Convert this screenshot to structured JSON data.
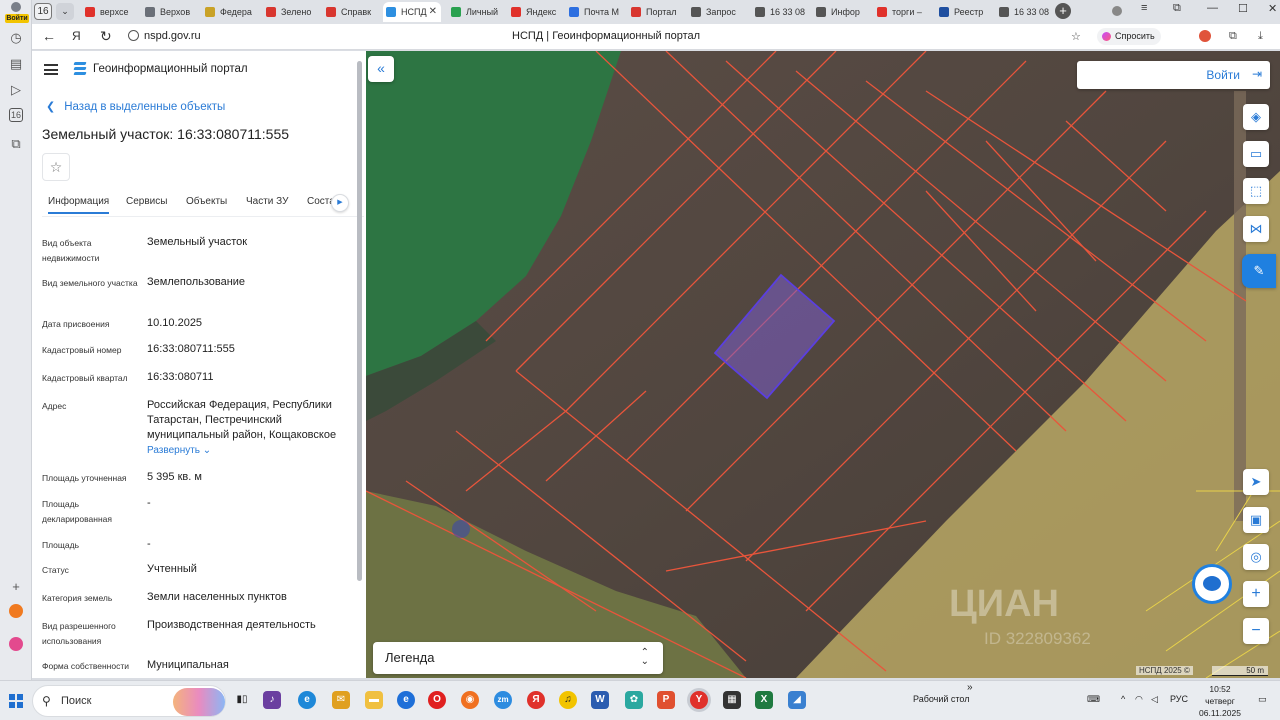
{
  "browser": {
    "tab_count": "16",
    "tabs": [
      {
        "label": "верхсе",
        "color": "#e0312b"
      },
      {
        "label": "Верхов",
        "color": "#6a6f78"
      },
      {
        "label": "Федера",
        "color": "#c9a227"
      },
      {
        "label": "Зелено",
        "color": "#d8362f"
      },
      {
        "label": "Справк",
        "color": "#d8362f"
      },
      {
        "label": "НСПД",
        "color": "#2d8fe0"
      },
      {
        "label": "Личный",
        "color": "#2aa150"
      },
      {
        "label": "Яндекс",
        "color": "#e0312b"
      },
      {
        "label": "Почта М",
        "color": "#2d6fe0"
      },
      {
        "label": "Портал",
        "color": "#d8362f"
      },
      {
        "label": "Запрос",
        "color": "#555"
      },
      {
        "label": "16 33 08",
        "color": "#555"
      },
      {
        "label": "Инфор",
        "color": "#555"
      },
      {
        "label": "торги –",
        "color": "#e0312b"
      },
      {
        "label": "Реестр",
        "color": "#1f4fa0"
      },
      {
        "label": "16 33 08",
        "color": "#555"
      }
    ],
    "url": "nspd.gov.ru",
    "page_title": "НСПД | Геоинформационный портал",
    "ask_label": "Спросить",
    "profile_badge": "Войти"
  },
  "panel": {
    "app_title": "Геоинформационный портал",
    "back_link": "Назад в выделенные объекты",
    "object_title": "Земельный участок: 16:33:080711:555",
    "tabs": [
      "Информация",
      "Сервисы",
      "Объекты",
      "Части ЗУ",
      "Соста"
    ],
    "active_tab": "Информация",
    "fields": [
      {
        "label": "Вид объекта недвижимости",
        "value": "Земельный участок"
      },
      {
        "label": "Вид земельного участка",
        "value": "Землепользование"
      },
      {
        "label": "Дата присвоения",
        "value": "10.10.2025"
      },
      {
        "label": "Кадастровый номер",
        "value": "16:33:080711:555"
      },
      {
        "label": "Кадастровый квартал",
        "value": "16:33:080711"
      },
      {
        "label": "Адрес",
        "value": "Российская Федерация, Республики Татарстан, Пестречинский муниципальный район, Кощаковское"
      },
      {
        "label": "Площадь уточненная",
        "value": "5 395 кв. м"
      },
      {
        "label": "Площадь декларированная",
        "value": "-"
      },
      {
        "label": "Площадь",
        "value": "-"
      },
      {
        "label": "Статус",
        "value": "Учтенный"
      },
      {
        "label": "Категория земель",
        "value": "Земли населенных пунктов"
      },
      {
        "label": "Вид разрешенного использования",
        "value": "Производственная деятельность"
      },
      {
        "label": "Форма собственности",
        "value": "Муниципальная"
      }
    ],
    "expand_label": "Развернуть"
  },
  "map": {
    "login_label": "Войти",
    "legend_label": "Легенда",
    "watermark": "ЦИАН",
    "watermark_id": "ID 322809362",
    "attribution": "НСПД 2025 ©",
    "scale": "50 m",
    "colors": {
      "parcel_line": "#e8553b",
      "selected_fill": "#7a5cc8",
      "forest": "#2f7a46",
      "yellow_zone": "#c9b870",
      "accent": "#2a7bd6"
    }
  },
  "taskbar": {
    "search_label": "Поиск",
    "desktop_label": "Рабочий стол",
    "lang": "РУС",
    "time": "10:52",
    "weekday": "четверг",
    "date": "06.11.2025"
  }
}
